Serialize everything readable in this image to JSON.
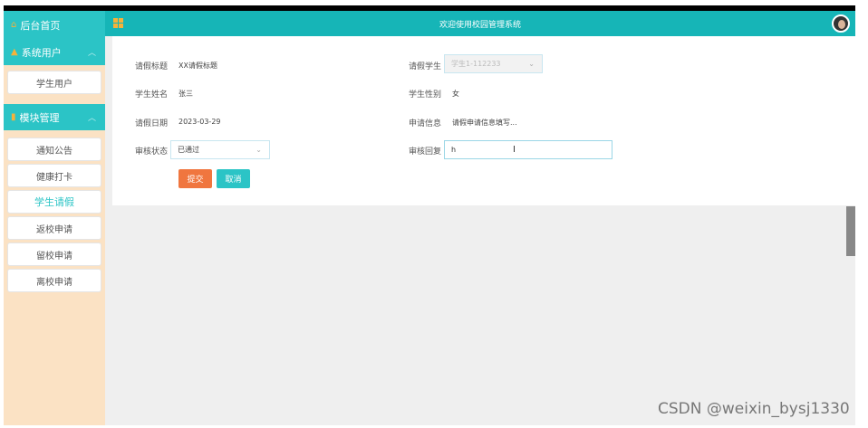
{
  "header": {
    "title": "欢迎使用校园管理系统"
  },
  "sidebar": {
    "home": "后台首页",
    "groups": [
      {
        "label": "系统用户",
        "items": [
          "学生用户"
        ]
      },
      {
        "label": "模块管理",
        "items": [
          "通知公告",
          "健康打卡",
          "学生请假",
          "返校申请",
          "留校申请",
          "离校申请"
        ]
      }
    ],
    "active_item": "学生请假"
  },
  "form": {
    "title_label": "请假标题",
    "title_value": "XX请假标题",
    "student_label": "请假学生",
    "student_value": "学生1-112233",
    "name_label": "学生姓名",
    "name_value": "张三",
    "gender_label": "学生性别",
    "gender_value": "女",
    "date_label": "请假日期",
    "date_value": "2023-03-29",
    "info_label": "申请信息",
    "info_value": "请假申请信息填写...",
    "status_label": "审核状态",
    "status_value": "已通过",
    "reply_label": "审核回复",
    "reply_value": "h",
    "submit_label": "提交",
    "cancel_label": "取消"
  },
  "watermark": "CSDN @weixin_bysj1330",
  "colors": {
    "accent": "#2bc4c6",
    "header": "#16b5b7",
    "sidebar_bg": "#fbe2c4",
    "submit": "#f0763f"
  }
}
